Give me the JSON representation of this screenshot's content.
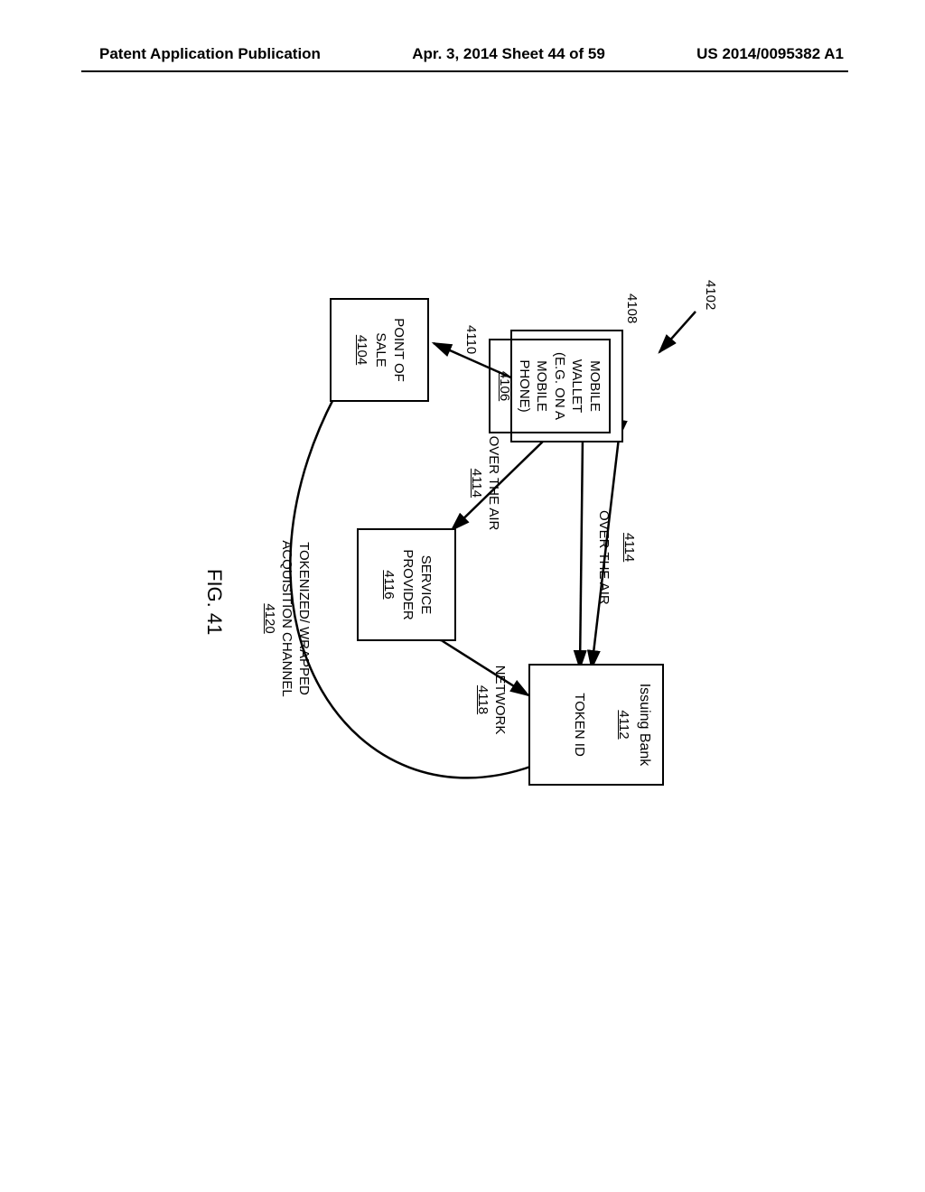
{
  "header": {
    "left": "Patent Application Publication",
    "center": "Apr. 3, 2014  Sheet 44 of 59",
    "right": "US 2014/0095382 A1"
  },
  "refs": {
    "ref_4102": "4102",
    "ref_4108": "4108",
    "ref_4110": "4110",
    "ref_4114_top": "4114"
  },
  "boxes": {
    "mobile_wallet": {
      "lines": [
        "MOBILE WALLET",
        "(E.G. ON A",
        "MOBILE PHONE)"
      ],
      "num": "4106"
    },
    "issuing_bank": {
      "title": "Issuing Bank",
      "num": "4112",
      "token": "TOKEN ID"
    },
    "service_provider": {
      "lines": [
        "SERVICE",
        "PROVIDER"
      ],
      "num": "4116"
    },
    "point_of_sale": {
      "lines": [
        "POINT OF",
        "SALE"
      ],
      "num": "4104"
    }
  },
  "labels": {
    "over_the_air_1": {
      "text": "OVER THE AIR"
    },
    "over_the_air_2": {
      "text": "OVER THE AIR",
      "num": "4114"
    },
    "network": {
      "text": "NETWORK",
      "num": "4118"
    },
    "tokenized": {
      "lines": [
        "TOKENIZED/ WRAPPED",
        "ACQUISITION CHANNEL"
      ],
      "num": "4120"
    }
  },
  "figure_label": "FIG. 41"
}
